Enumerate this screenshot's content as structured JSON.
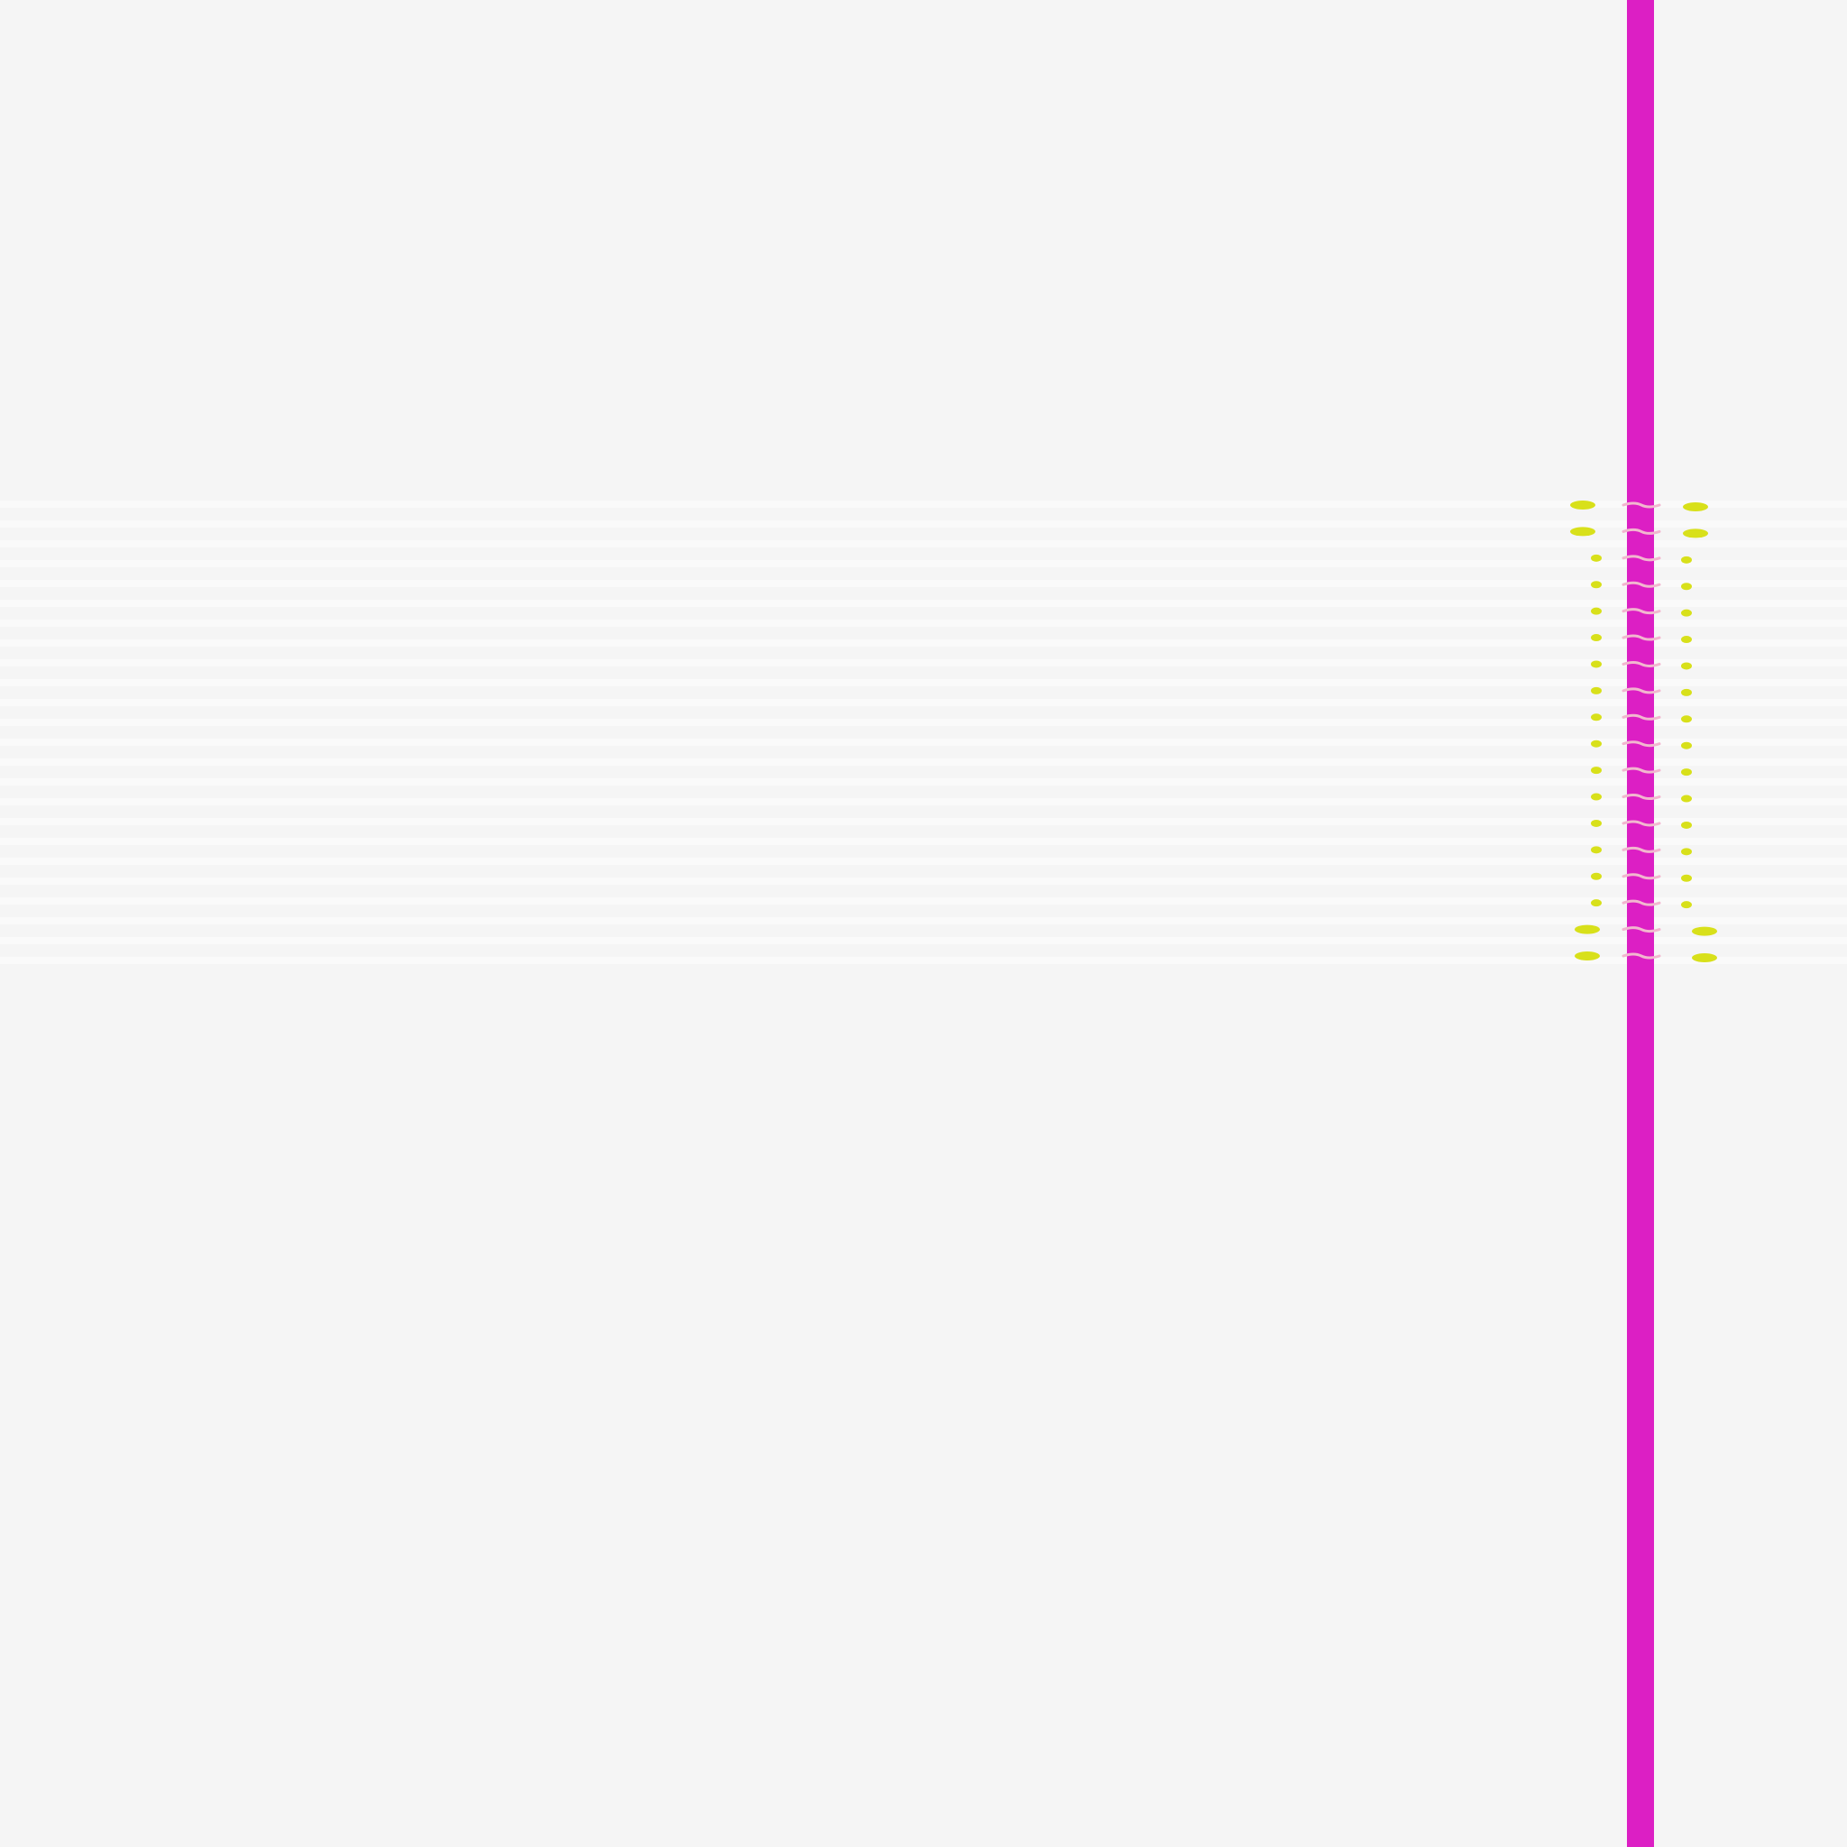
{
  "canvas": {
    "background": "#f5f5f5"
  },
  "elements": {
    "vertical_line": {
      "color": "#dc1fc4"
    },
    "motif": {
      "name": "stitched-leaf-pattern",
      "leaf_color": "#d8e01a",
      "stitch_color": "#f2b7cf",
      "band_color": "#ffffff",
      "leaf_pairs": 18
    }
  }
}
